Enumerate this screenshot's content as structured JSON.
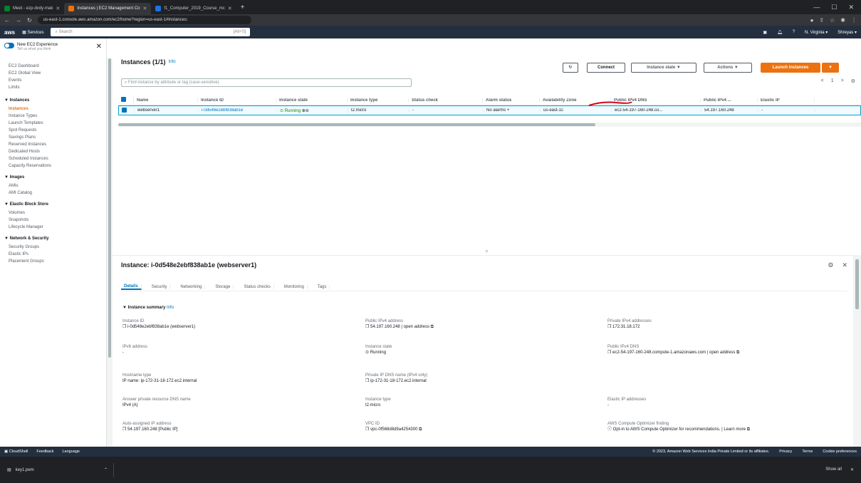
{
  "browser": {
    "tabs": [
      {
        "title": "Meet - ezp-dvdy-mak",
        "active": false
      },
      {
        "title": "Instances | EC2 Management Co",
        "active": true
      },
      {
        "title": "f1_Computer_2019_Course_mc",
        "active": false
      }
    ],
    "url": "us-east-1.console.aws.amazon.com/ec2/home?region=us-east-1#Instances:"
  },
  "aws_nav": {
    "logo": "aws",
    "services": "Services",
    "search_placeholder": "Search",
    "search_shortcut": "[Alt+S]",
    "region": "N. Virginia ▾",
    "user": "Shreyas ▾"
  },
  "sidebar": {
    "toggle_label": "New EC2 Experience",
    "toggle_sub": "Tell us what you think",
    "top_items": [
      "EC2 Dashboard",
      "EC2 Global View",
      "Events",
      "Limits"
    ],
    "sections": [
      {
        "title": "▼ Instances",
        "items": [
          "Instances",
          "Instance Types",
          "Launch Templates",
          "Spot Requests",
          "Savings Plans",
          "Reserved Instances",
          "Dedicated Hosts",
          "Scheduled Instances",
          "Capacity Reservations"
        ]
      },
      {
        "title": "▼ Images",
        "items": [
          "AMIs",
          "AMI Catalog"
        ]
      },
      {
        "title": "▼ Elastic Block Store",
        "items": [
          "Volumes",
          "Snapshots",
          "Lifecycle Manager"
        ]
      },
      {
        "title": "▼ Network & Security",
        "items": [
          "Security Groups",
          "Elastic IPs",
          "Placement Groups"
        ]
      }
    ],
    "active_item": "Instances"
  },
  "main": {
    "title": "Instances (1/1)",
    "info": "Info",
    "buttons": {
      "refresh": "↻",
      "connect": "Connect",
      "instance_state": "Instance state ▼",
      "actions": "Actions ▼",
      "launch": "Launch instances",
      "launch_dd": "▼"
    },
    "filter_placeholder": "Find instance by attribute or tag (case-sensitive)",
    "pager": {
      "prev": "<",
      "page": "1",
      "next": ">",
      "settings": "⚙"
    },
    "columns": [
      "Name",
      "Instance ID",
      "Instance state",
      "Instance type",
      "Status check",
      "Alarm status",
      "Availability Zone",
      "Public IPv4 DNS",
      "Public IPv4 ...",
      "Elastic IP"
    ],
    "rows": [
      {
        "name": "webserver1",
        "id": "i-0d548e2ebf838ab1e",
        "state": "⊙ Running",
        "state_icons": "⊕⊖",
        "type": "t2.micro",
        "status": "-",
        "alarm": "No alarms",
        "alarm_add": "+",
        "az": "us-east-1c",
        "dns": "ec2-54-197-160-248.co...",
        "ip": "54.197.160.248",
        "eip": "-"
      }
    ]
  },
  "details": {
    "title": "Instance: i-0d548e2ebf838ab1e (webserver1)",
    "tabs": [
      "Details",
      "Security",
      "Networking",
      "Storage",
      "Status checks",
      "Monitoring",
      "Tags"
    ],
    "summary": "▼ Instance summary",
    "summary_info": "Info",
    "fields": [
      {
        "label": "Instance ID",
        "value": "❐ i-0d548e2ebf838ab1e (webserver1)"
      },
      {
        "label": "Public IPv4 address",
        "value": "❐ 54.197.160.248 | open address ⧉"
      },
      {
        "label": "Private IPv4 addresses",
        "value": "❐ 172.31.18.172"
      },
      {
        "label": "IPv6 address",
        "value": "-"
      },
      {
        "label": "Instance state",
        "value": "⊙ Running"
      },
      {
        "label": "Public IPv4 DNS",
        "value": "❐ ec2-54-197-160-248.compute-1.amazonaws.com | open address ⧉"
      },
      {
        "label": "Hostname type",
        "value": "IP name: ip-172-31-18-172.ec2.internal"
      },
      {
        "label": "Private IP DNS name (IPv4 only)",
        "value": "❐ ip-172-31-18-172.ec2.internal"
      },
      {
        "label": "Answer private resource DNS name",
        "value": "IPv4 (A)"
      },
      {
        "label": "Instance type",
        "value": "t2.micro"
      },
      {
        "label": "Elastic IP addresses",
        "value": "-"
      },
      {
        "label": "Auto-assigned IP address",
        "value": "❐ 54.197.160.248 [Public IP]"
      },
      {
        "label": "VPC ID",
        "value": "❐ vpc-0f568d8d9a4254300 ⧉"
      },
      {
        "label": "AWS Compute Optimizer finding",
        "value": "ⓘ Opt-in to AWS Compute Optimizer for recommendations. | Learn more ⧉"
      }
    ]
  },
  "footer": {
    "cloudshell": "CloudShell",
    "feedback": "Feedback",
    "language": "Language",
    "copyright": "© 2023, Amazon Web Services India Private Limited or its affiliates.",
    "privacy": "Privacy",
    "terms": "Terms",
    "cookies": "Cookie preferences"
  },
  "downloads": {
    "file": "key1.pem",
    "show_all": "Show all",
    "close": "✕"
  },
  "colors": {
    "aws_nav": "#232f3e",
    "accent": "#ec7211",
    "link": "#0073bb",
    "running": "#1d8102",
    "annotation": "#d0021b"
  }
}
